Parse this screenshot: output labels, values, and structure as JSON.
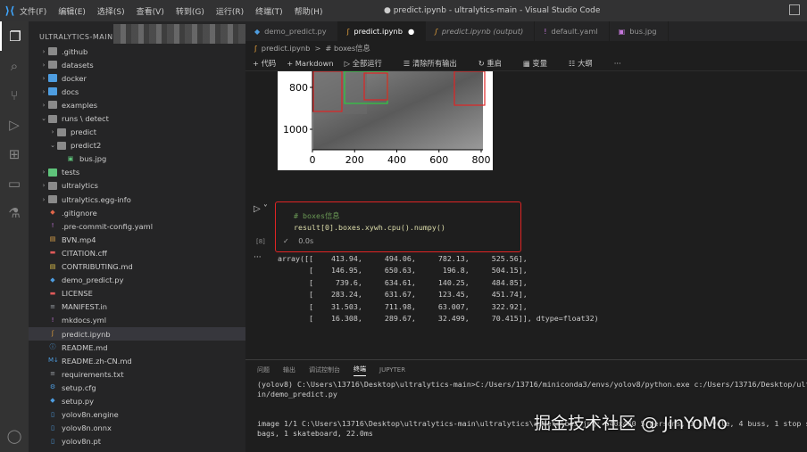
{
  "titlebar": {
    "menu": [
      "文件(F)",
      "编辑(E)",
      "选择(S)",
      "查看(V)",
      "转到(G)",
      "运行(R)",
      "终端(T)",
      "帮助(H)"
    ],
    "window_title": "● predict.ipynb - ultralytics-main - Visual Studio Code"
  },
  "sidebar": {
    "header": "ULTRALYTICS-MAIN",
    "items": [
      {
        "label": ".github",
        "kind": "folder",
        "indent": 0
      },
      {
        "label": "datasets",
        "kind": "folder",
        "indent": 0
      },
      {
        "label": "docker",
        "kind": "folder-blue",
        "indent": 0
      },
      {
        "label": "docs",
        "kind": "folder-blue",
        "indent": 0
      },
      {
        "label": "examples",
        "kind": "folder",
        "indent": 0
      },
      {
        "label": "runs \\ detect",
        "kind": "folder-open",
        "indent": 0
      },
      {
        "label": "predict",
        "kind": "folder",
        "indent": 1
      },
      {
        "label": "predict2",
        "kind": "folder-open",
        "indent": 1
      },
      {
        "label": "bus.jpg",
        "kind": "image",
        "indent": 2
      },
      {
        "label": "tests",
        "kind": "folder-green",
        "indent": 0
      },
      {
        "label": "ultralytics",
        "kind": "folder",
        "indent": 0
      },
      {
        "label": "ultralytics.egg-info",
        "kind": "folder",
        "indent": 0
      },
      {
        "label": ".gitignore",
        "kind": "file-git",
        "indent": 0
      },
      {
        "label": ".pre-commit-config.yaml",
        "kind": "file-yaml",
        "indent": 0
      },
      {
        "label": "BVN.mp4",
        "kind": "file-media",
        "indent": 0
      },
      {
        "label": "CITATION.cff",
        "kind": "file-red",
        "indent": 0
      },
      {
        "label": "CONTRIBUTING.md",
        "kind": "file-yellow",
        "indent": 0
      },
      {
        "label": "demo_predict.py",
        "kind": "file-py",
        "indent": 0
      },
      {
        "label": "LICENSE",
        "kind": "file-red",
        "indent": 0
      },
      {
        "label": "MANIFEST.in",
        "kind": "file-list",
        "indent": 0
      },
      {
        "label": "mkdocs.yml",
        "kind": "file-yaml",
        "indent": 0
      },
      {
        "label": "predict.ipynb",
        "kind": "file-nb",
        "indent": 0,
        "selected": true
      },
      {
        "label": "README.md",
        "kind": "file-info",
        "indent": 0
      },
      {
        "label": "README.zh-CN.md",
        "kind": "file-md",
        "indent": 0
      },
      {
        "label": "requirements.txt",
        "kind": "file-list",
        "indent": 0
      },
      {
        "label": "setup.cfg",
        "kind": "file-gear",
        "indent": 0
      },
      {
        "label": "setup.py",
        "kind": "file-py",
        "indent": 0
      },
      {
        "label": "yolov8n.engine",
        "kind": "file-blank",
        "indent": 0
      },
      {
        "label": "yolov8n.onnx",
        "kind": "file-blank",
        "indent": 0
      },
      {
        "label": "yolov8n.pt",
        "kind": "file-blank",
        "indent": 0
      }
    ]
  },
  "tabs": [
    {
      "label": "demo_predict.py",
      "icon": "python-icon",
      "active": false,
      "italic": false
    },
    {
      "label": "predict.ipynb",
      "icon": "notebook-icon",
      "active": true,
      "italic": false,
      "dirty": "●"
    },
    {
      "label": "predict.ipynb (output)",
      "icon": "notebook-icon",
      "active": false,
      "italic": true
    },
    {
      "label": "default.yaml",
      "icon": "yaml-icon",
      "active": false,
      "italic": false
    },
    {
      "label": "bus.jpg",
      "icon": "image-icon",
      "active": false,
      "italic": false
    }
  ],
  "breadcrumb": {
    "file": "predict.ipynb",
    "sep": ">",
    "section": "# boxes信息"
  },
  "toolbar": {
    "code": "+ 代码",
    "markdown": "+ Markdown",
    "run_all": "全部运行",
    "clear_outputs": "清除所有输出",
    "restart": "重启",
    "variables": "变量",
    "outline": "大纲",
    "more": "···"
  },
  "plot": {
    "y_ticks": [
      "800",
      "1000"
    ],
    "x_ticks": [
      "0",
      "200",
      "400",
      "600",
      "800"
    ]
  },
  "cell": {
    "comment": "# boxes信息",
    "code": "result[0].boxes.xywh.cpu().numpy()",
    "exec_count": "[8]",
    "status": "✓",
    "time": "0.0s"
  },
  "output": {
    "dots": "···",
    "lines": [
      "array([[    413.94,     494.06,     782.13,     525.56],",
      "       [    146.95,     650.63,      196.8,     504.15],",
      "       [     739.6,     634.61,     140.25,     484.85],",
      "       [    283.24,     631.67,     123.45,     451.74],",
      "       [    31.503,     711.98,     63.007,     322.92],",
      "       [    16.308,     289.67,     32.499,     70.415]], dtype=float32)"
    ]
  },
  "panel": {
    "tabs": [
      "问题",
      "输出",
      "调试控制台",
      "终端",
      "JUPYTER"
    ],
    "active_tab": "终端",
    "terminal_lines": [
      "(yolov8) C:\\Users\\13716\\Desktop\\ultralytics-main>C:/Users/13716/miniconda3/envs/yolov8/python.exe c:/Users/13716/Desktop/ultr",
      "in/demo_predict.py",
      "",
      "",
      "image 1/1 C:\\Users\\13716\\Desktop\\ultralytics-main\\ultralytics\\assets\\bus.jpg: 640x480 5 persons, 1 bicycle, 4 buss, 1 stop si",
      "bags, 1 skateboard, 22.0ms"
    ]
  },
  "watermark": "掘金技术社区 @ JinYoMo",
  "colors": {
    "accent_red": "#e02424",
    "activity_bg": "#333333",
    "sidebar_bg": "#252526",
    "editor_bg": "#1e1e1e"
  }
}
